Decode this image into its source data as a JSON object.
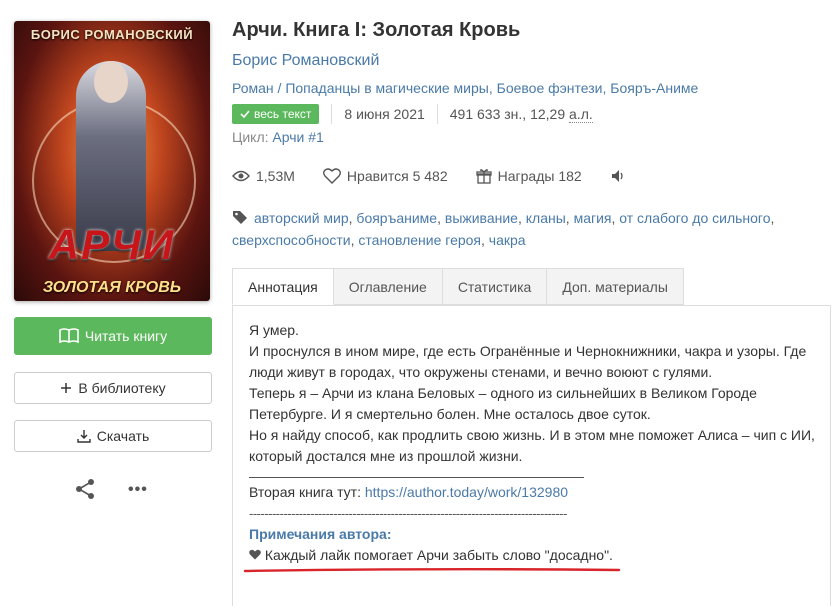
{
  "cover": {
    "author": "БОРИС РОМАНОВСКИЙ",
    "title": "АРЧИ",
    "subtitle": "ЗОЛОТАЯ КРОВЬ"
  },
  "actions": {
    "read": "Читать книгу",
    "library": "В библиотеку",
    "download": "Скачать"
  },
  "book": {
    "title": "Арчи. Книга I: Золотая Кровь",
    "author": "Борис Романовский",
    "genres": "Роман / Попаданцы в магические миры, Боевое фэнтези, Бояръ-Аниме",
    "status": "весь текст",
    "date": "8 июня 2021",
    "size": "491 633 зн., 12,29",
    "size_unit": "а.л.",
    "cycle_label": "Цикл:",
    "cycle": "Арчи #1"
  },
  "stats": {
    "views": "1,53M",
    "likes_label": "Нравится",
    "likes": "5 482",
    "awards_label": "Награды",
    "awards": "182"
  },
  "tags": [
    "авторский мир",
    "бояръаниме",
    "выживание",
    "кланы",
    "магия",
    "от слабого до сильного",
    "сверхспособности",
    "становление героя",
    "чакра"
  ],
  "tabs": [
    "Аннотация",
    "Оглавление",
    "Статистика",
    "Доп. материалы"
  ],
  "annotation": {
    "lines": [
      "Я умер.",
      "И проснулся в ином мире, где есть Огранённые и Чернокнижники, чакра и узоры. Где люди живут в городах, что окружены стенами, и вечно воюют с гулями.",
      "Теперь я – Арчи из клана Беловых – одного из сильнейших в Великом Городе Петербурге. И я смертельно болен. Мне осталось двое суток.",
      "Но я найду способ, как продлить свою жизнь. И в этом мне поможет Алиса – чип с ИИ, который достался мне из прошлой жизни."
    ],
    "second_book_label": "Вторая книга тут:",
    "second_book_link": "https://author.today/work/132980",
    "dashes": "-----------------------------------------------------------------------------------",
    "notes_heading": "Примечания автора:",
    "note": "Каждый лайк помогает Арчи забыть слово \"досадно\"."
  },
  "colors": {
    "accent": "#5cb85c",
    "link": "#4a7aa8",
    "underline": "#d9252a"
  }
}
